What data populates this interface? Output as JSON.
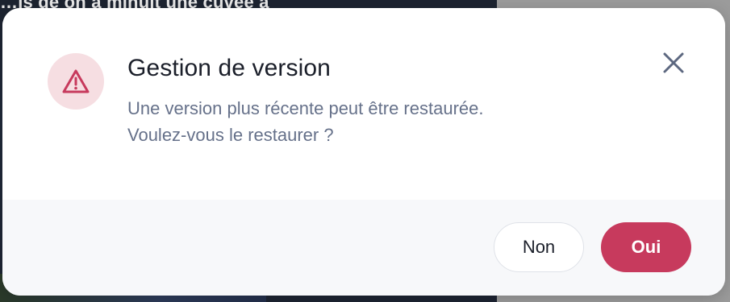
{
  "background": {
    "partial_text": "…is de on a minuit une cuvée à"
  },
  "dialog": {
    "title": "Gestion de version",
    "message_line1": "Une version plus récente peut être restaurée.",
    "message_line2": "Voulez-vous le restaurer ?",
    "icon": "warning-triangle-icon",
    "close_icon": "close-icon",
    "buttons": {
      "no_label": "Non",
      "yes_label": "Oui"
    }
  },
  "colors": {
    "accent": "#c73a5d",
    "icon_bg": "#f6dee2",
    "message_text": "#66718a",
    "title_text": "#1b1f2a",
    "footer_bg": "#f7f8fa"
  }
}
